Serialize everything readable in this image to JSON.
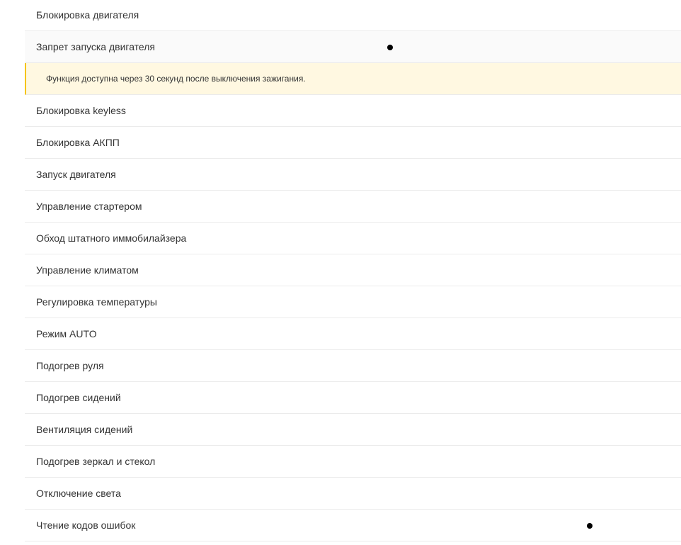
{
  "rows": [
    {
      "label": "Блокировка двигателя"
    },
    {
      "label": "Запрет запуска двигателя",
      "dot": "col-1"
    },
    {
      "label": "Блокировка keyless"
    },
    {
      "label": "Блокировка АКПП"
    },
    {
      "label": "Запуск двигателя"
    },
    {
      "label": "Управление стартером"
    },
    {
      "label": "Обход штатного иммобилайзера"
    },
    {
      "label": "Управление климатом"
    },
    {
      "label": "Регулировка температуры"
    },
    {
      "label": "Режим AUTO"
    },
    {
      "label": "Подогрев руля"
    },
    {
      "label": "Подогрев сидений"
    },
    {
      "label": "Вентиляция сидений"
    },
    {
      "label": "Подогрев зеркал и стекол"
    },
    {
      "label": "Отключение света"
    },
    {
      "label": "Чтение кодов ошибок",
      "dot": "col-2"
    }
  ],
  "notice": {
    "text": "Функция доступна через 30 секунд после выключения зажигания."
  },
  "colors": {
    "notice_background": "#fff8e1",
    "notice_accent": "#f5c518",
    "divider": "#ebebeb",
    "text": "#333333"
  }
}
